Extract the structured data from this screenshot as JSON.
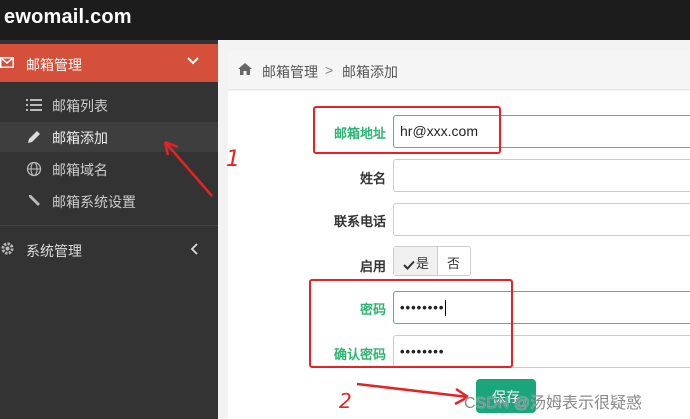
{
  "app": {
    "brand": "ewomail.com"
  },
  "sidebar": {
    "mail_menu": {
      "label": "邮箱管理",
      "icon": "envelope-icon"
    },
    "sub_items": [
      {
        "label": "邮箱列表",
        "icon": "list-icon",
        "active": false
      },
      {
        "label": "邮箱添加",
        "icon": "pencil-icon",
        "active": true
      },
      {
        "label": "邮箱域名",
        "icon": "globe-icon",
        "active": false
      },
      {
        "label": "邮箱系统设置",
        "icon": "wrench-icon",
        "active": false
      }
    ],
    "system_menu": {
      "label": "系统管理",
      "icon": "gear-icon"
    }
  },
  "breadcrumb": {
    "items": [
      "邮箱管理",
      "邮箱添加"
    ],
    "separator": ">"
  },
  "form": {
    "email": {
      "label": "邮箱地址",
      "value": "hr@xxx.com"
    },
    "name": {
      "label": "姓名",
      "value": ""
    },
    "phone": {
      "label": "联系电话",
      "value": ""
    },
    "enable": {
      "label": "启用",
      "yes": "是",
      "no": "否",
      "selected": "是"
    },
    "password": {
      "label": "密码",
      "value": "••••••••"
    },
    "confirm_password": {
      "label": "确认密码",
      "value": "••••••••"
    },
    "save_label": "保存"
  },
  "annotations": {
    "mark1": "1",
    "mark2": "2"
  },
  "watermark": "CSDN @汤姆表示很疑惑",
  "colors": {
    "accent_red": "#d4503b",
    "save_green": "#1aa57a",
    "label_green": "#2eb472",
    "annotation_red": "#e42424"
  }
}
